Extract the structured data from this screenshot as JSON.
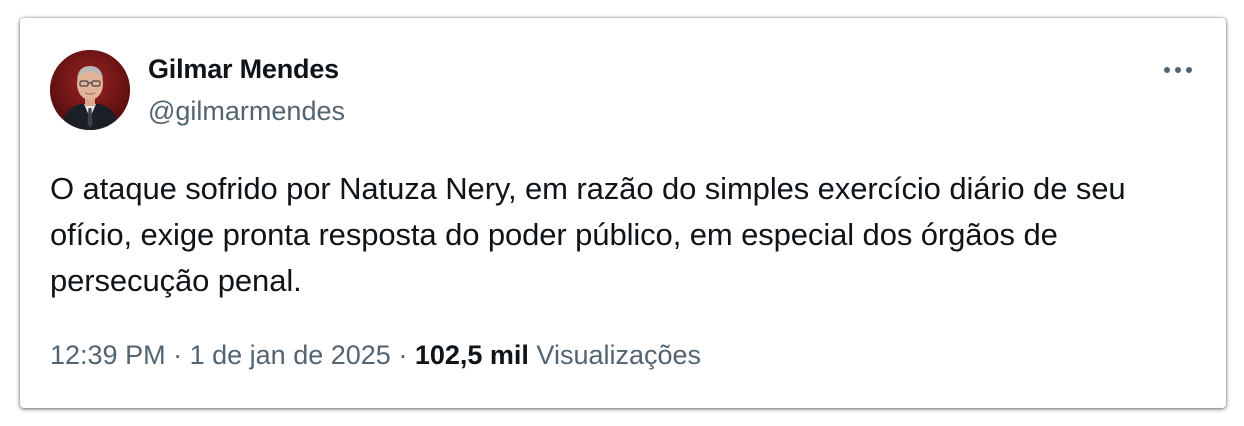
{
  "author": {
    "display_name": "Gilmar Mendes",
    "handle": "@gilmarmendes",
    "avatar_icon": "profile-photo"
  },
  "more_icon": "more-horizontal-icon",
  "tweet": {
    "text": "O ataque sofrido por Natuza Nery, em razão do simples exercício diário de seu ofício, exige pronta resposta do poder público, em especial dos órgãos de persecução penal."
  },
  "meta": {
    "time": "12:39 PM",
    "separator": "·",
    "date": "1 de jan de 2025",
    "views_count": "102,5 mil",
    "views_label": "Visualizações"
  },
  "colors": {
    "text_primary": "#0f1419",
    "text_secondary": "#536471",
    "background": "#ffffff"
  }
}
